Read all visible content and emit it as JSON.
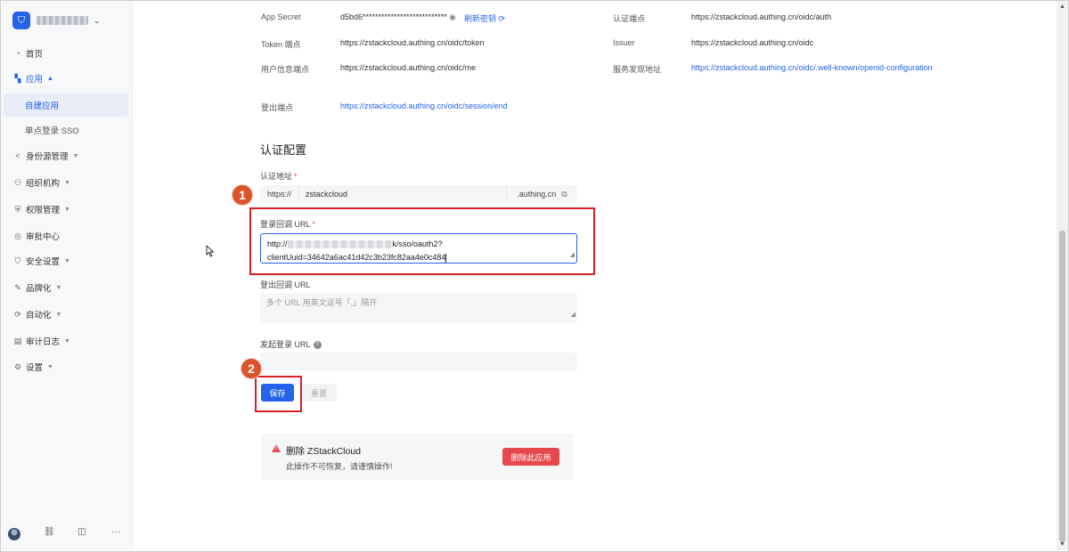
{
  "sidebar": {
    "org_chevron": "⌄",
    "nav": [
      {
        "label": "首页",
        "icon": "dashboard-icon"
      },
      {
        "label": "应用",
        "icon": "apps-icon"
      },
      {
        "label": "身份源管理",
        "icon": "share-icon"
      },
      {
        "label": "组织机构",
        "icon": "org-icon"
      },
      {
        "label": "权限管理",
        "icon": "permission-icon"
      },
      {
        "label": "审批中心",
        "icon": "approval-icon"
      },
      {
        "label": "安全设置",
        "icon": "security-icon"
      },
      {
        "label": "品牌化",
        "icon": "brush-icon"
      },
      {
        "label": "自动化",
        "icon": "automation-icon"
      },
      {
        "label": "审计日志",
        "icon": "log-icon"
      },
      {
        "label": "设置",
        "icon": "gear-icon"
      }
    ],
    "sub": [
      {
        "label": "自建应用"
      },
      {
        "label": "单点登录 SSO"
      }
    ],
    "bottom": {
      "more": "···"
    }
  },
  "endpoints": {
    "app_secret_label": "App Secret",
    "app_secret_value": "d5bd6***************************",
    "refresh_secret": "刷新密钥",
    "token_label": "Token 端点",
    "token_value": "https://zstackcloud.authing.cn/oidc/token",
    "userinfo_label": "用户信息端点",
    "userinfo_value": "https://zstackcloud.authing.cn/oidc/me",
    "logout_label": "登出端点",
    "logout_value": "https://zstackcloud.authing.cn/oidc/session/end",
    "auth_label": "认证端点",
    "auth_value": "https://zstackcloud.authing.cn/oidc/auth",
    "issuer_label": "Issuer",
    "issuer_value": "https://zstackcloud.authing.cn/oidc",
    "discovery_label": "服务发现地址",
    "discovery_value": "https://zstackcloud.authing.cn/oidc/.well-known/openid-configuration"
  },
  "auth_config": {
    "title": "认证配置",
    "auth_url_label": "认证地址",
    "required_mark": "*",
    "url_prefix": "https://",
    "url_value": "zstackcloud",
    "url_suffix": ".authing.cn",
    "callback_label": "登录回调 URL",
    "callback_line1_start": "http://",
    "callback_line1_end": "k/sso/oauth2?",
    "callback_line2": "clientUuid=34642a6ac41d42c3b23fc82aa4e0c484",
    "logout_callback_label": "登出回调 URL",
    "logout_callback_placeholder": "多个 URL 用英文逗号「,」隔开",
    "initiate_login_label": "发起登录 URL",
    "save_button": "保存",
    "reset_button": "重置"
  },
  "danger_zone": {
    "title": "删除 ZStackCloud",
    "description": "此操作不可恢复，请谨慎操作!",
    "delete_button": "删除此应用"
  },
  "annotations": {
    "step1": "1",
    "step2": "2"
  }
}
